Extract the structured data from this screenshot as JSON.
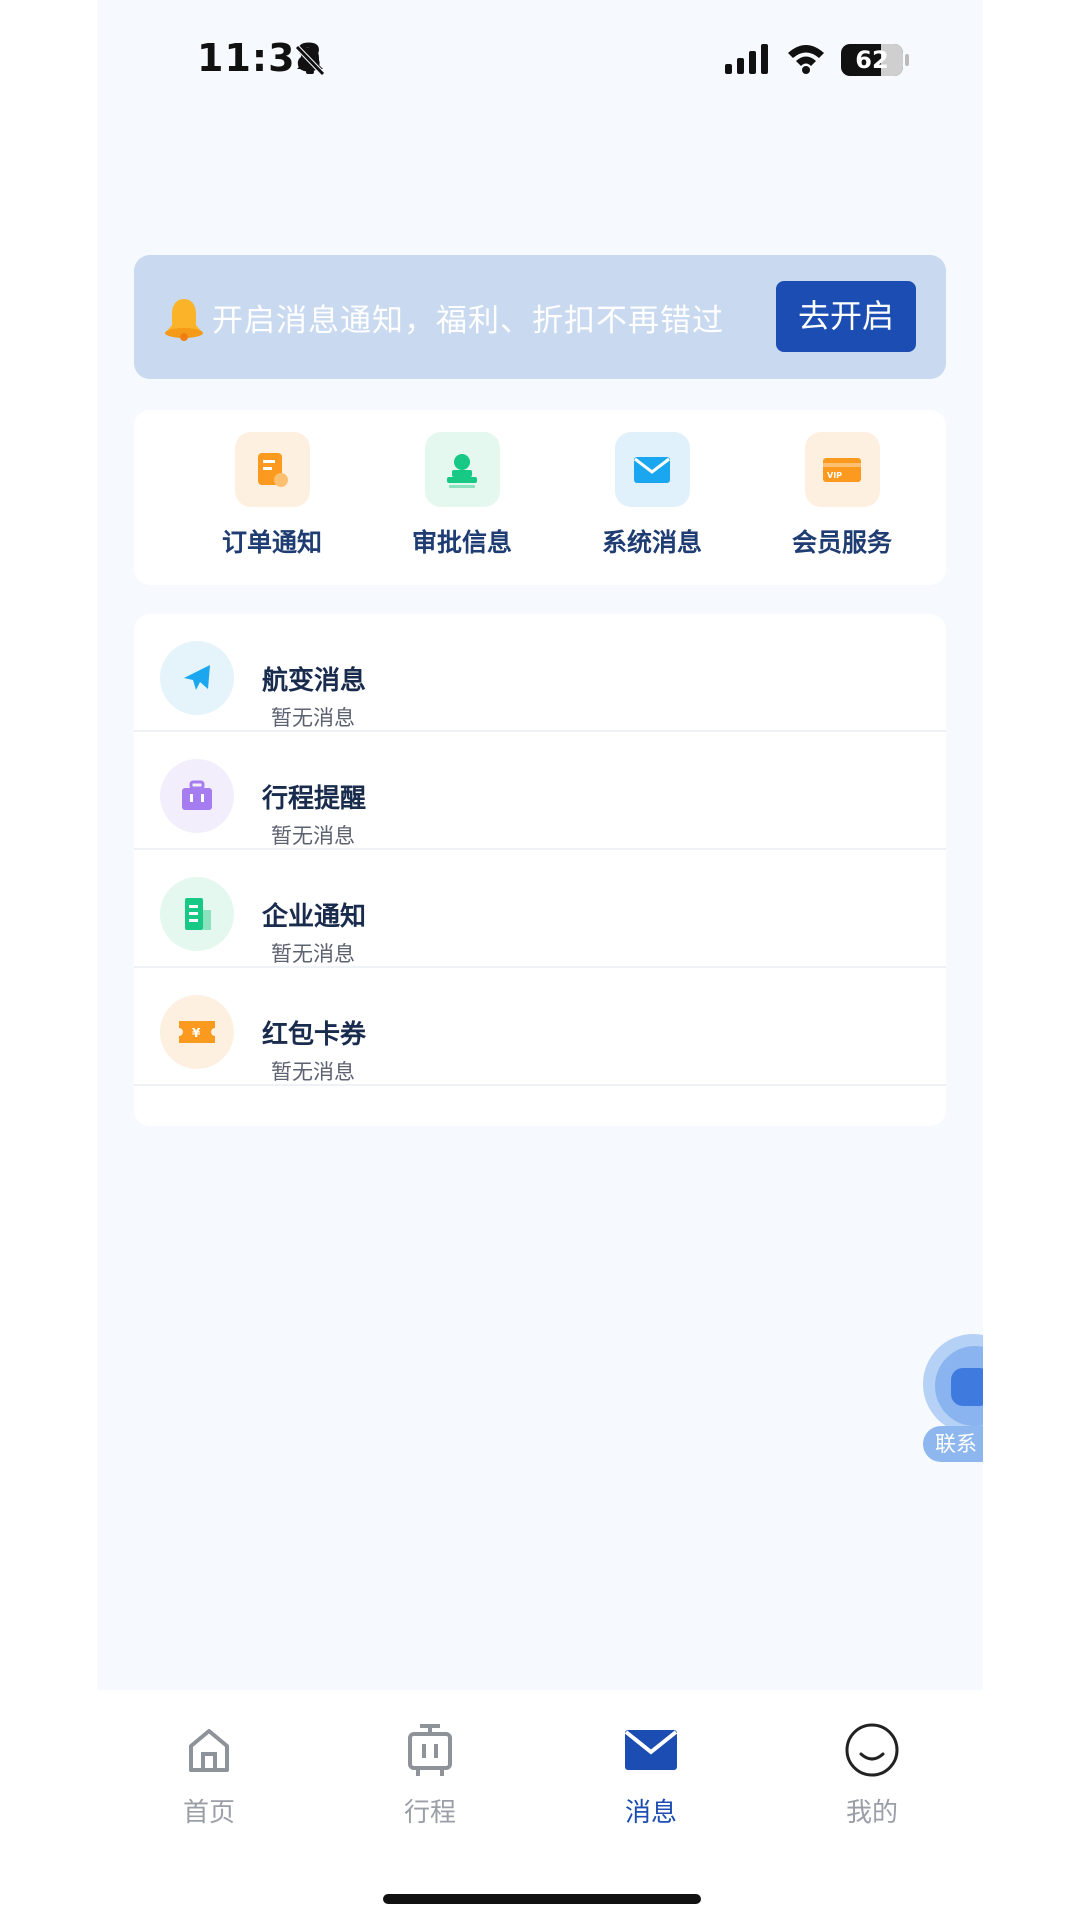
{
  "status_bar": {
    "time": "11:38",
    "battery": "62"
  },
  "notify_banner": {
    "text": "开启消息通知，福利、折扣不再错过",
    "button": "去开启"
  },
  "categories": [
    {
      "label": "订单通知",
      "icon": "order-icon",
      "color": "#fb9a1e"
    },
    {
      "label": "审批信息",
      "icon": "approval-icon",
      "color": "#18c986"
    },
    {
      "label": "系统消息",
      "icon": "mail-icon",
      "color": "#1aa7f0"
    },
    {
      "label": "会员服务",
      "icon": "vip-card-icon",
      "color": "#fb9a1e"
    }
  ],
  "messages": [
    {
      "title": "航变消息",
      "subtitle": "暂无消息",
      "icon": "plane-icon"
    },
    {
      "title": "行程提醒",
      "subtitle": "暂无消息",
      "icon": "suitcase-icon"
    },
    {
      "title": "企业通知",
      "subtitle": "暂无消息",
      "icon": "building-icon"
    },
    {
      "title": "红包卡券",
      "subtitle": "暂无消息",
      "icon": "coupon-icon"
    }
  ],
  "support": {
    "label": "联系"
  },
  "tabs": [
    {
      "label": "首页",
      "icon": "home-icon",
      "active": false
    },
    {
      "label": "行程",
      "icon": "trip-icon",
      "active": false
    },
    {
      "label": "消息",
      "icon": "message-icon",
      "active": true
    },
    {
      "label": "我的",
      "icon": "profile-icon",
      "active": false
    }
  ],
  "colors": {
    "accent": "#1c4db3",
    "banner_bg": "#c9d9ef",
    "page_bg": "#f6f9fd"
  }
}
